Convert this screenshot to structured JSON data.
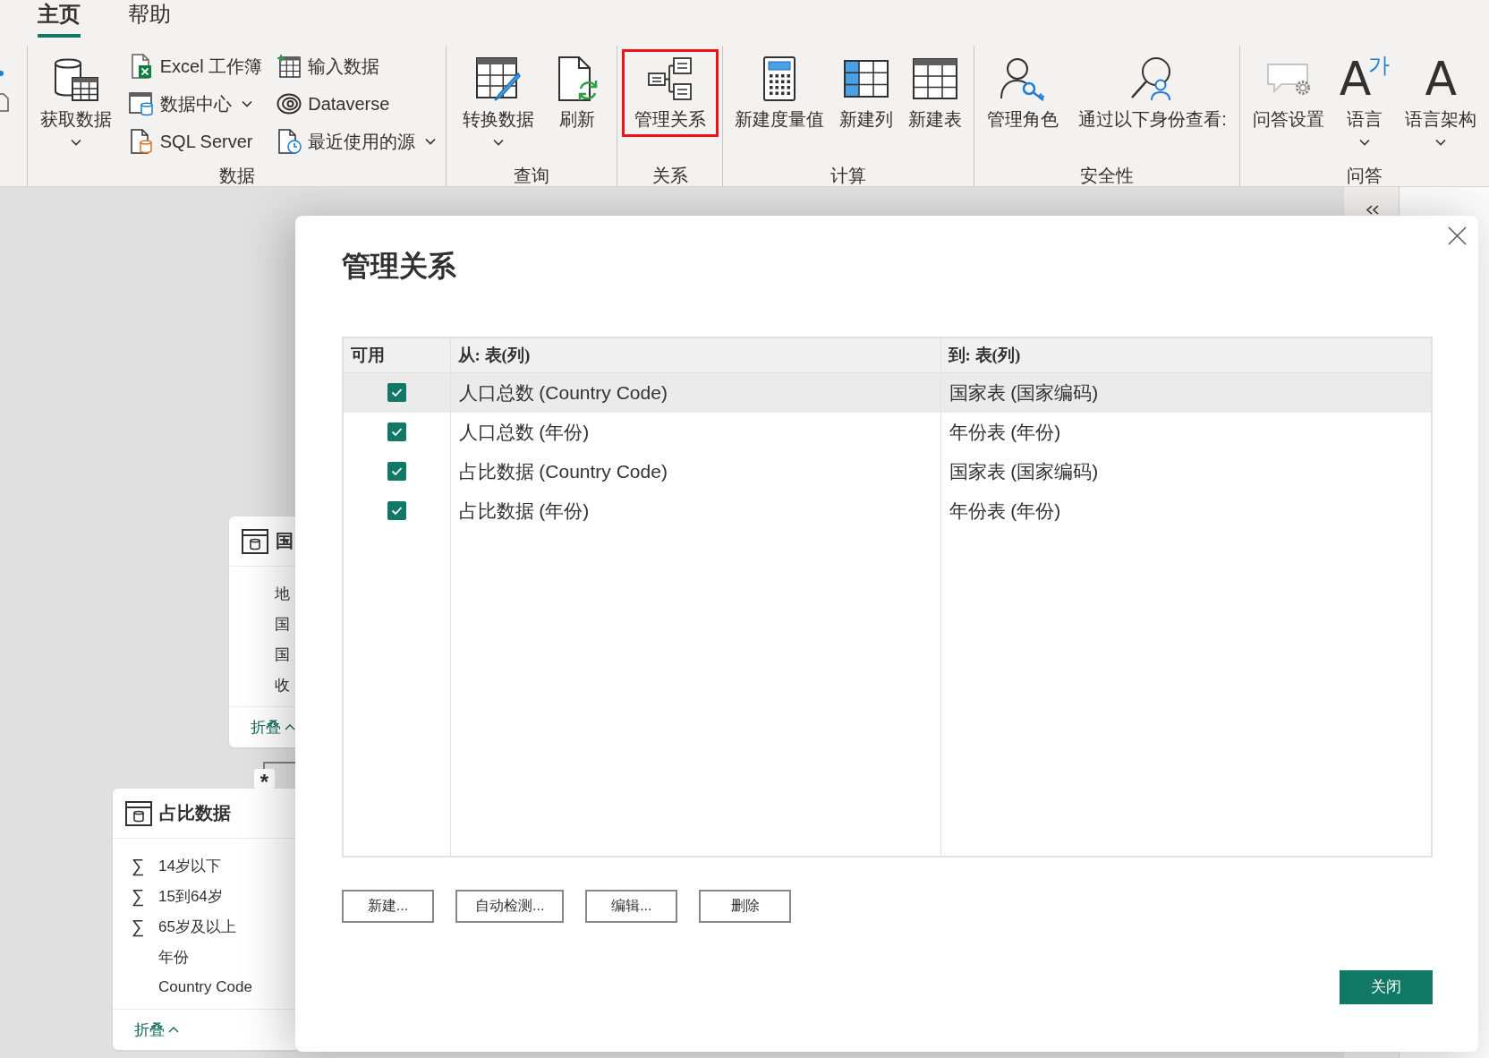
{
  "ribbon": {
    "tabs": [
      {
        "label": "主页",
        "selected": true
      },
      {
        "label": "帮助",
        "selected": false
      }
    ],
    "groups": [
      {
        "label": "数据",
        "items": [
          {
            "kind": "large",
            "label": "获取数据",
            "dropdown": true,
            "highlighted": false
          },
          {
            "kind": "small",
            "label": "Excel 工作簿",
            "dropdown": false,
            "highlighted": false
          },
          {
            "kind": "small",
            "label": "数据中心",
            "dropdown": true,
            "highlighted": false
          },
          {
            "kind": "small",
            "label": "SQL Server",
            "dropdown": false,
            "highlighted": false
          },
          {
            "kind": "small",
            "label": "输入数据",
            "dropdown": false,
            "highlighted": false
          },
          {
            "kind": "small",
            "label": "Dataverse",
            "dropdown": false,
            "highlighted": false
          },
          {
            "kind": "small",
            "label": "最近使用的源",
            "dropdown": true,
            "highlighted": false
          }
        ]
      },
      {
        "label": "查询",
        "items": [
          {
            "kind": "large",
            "label": "转换数据",
            "dropdown": true,
            "highlighted": false
          },
          {
            "kind": "large",
            "label": "刷新",
            "dropdown": false,
            "highlighted": false
          }
        ]
      },
      {
        "label": "关系",
        "items": [
          {
            "kind": "large",
            "label": "管理关系",
            "dropdown": false,
            "highlighted": true
          }
        ]
      },
      {
        "label": "计算",
        "items": [
          {
            "kind": "large",
            "label": "新建度量值",
            "dropdown": false,
            "highlighted": false
          },
          {
            "kind": "large",
            "label": "新建列",
            "dropdown": false,
            "highlighted": false
          },
          {
            "kind": "large",
            "label": "新建表",
            "dropdown": false,
            "highlighted": false
          }
        ]
      },
      {
        "label": "安全性",
        "items": [
          {
            "kind": "large",
            "label": "管理角色",
            "dropdown": false,
            "highlighted": false
          },
          {
            "kind": "large",
            "label": "通过以下身份查看:",
            "dropdown": false,
            "highlighted": false
          }
        ]
      },
      {
        "label": "问答",
        "items": [
          {
            "kind": "large",
            "label": "问答设置",
            "dropdown": false,
            "highlighted": false
          },
          {
            "kind": "large",
            "label": "语言",
            "glyph": "A$^{가}$",
            "dropdown": true,
            "highlighted": false
          },
          {
            "kind": "large",
            "label": "语言架构",
            "glyph": "A",
            "dropdown": true,
            "highlighted": false
          }
        ]
      }
    ]
  },
  "canvas": {
    "tables": [
      {
        "title": "国",
        "fields": [
          {
            "label": "地"
          },
          {
            "label": "国"
          },
          {
            "label": "国"
          },
          {
            "label": "收"
          }
        ],
        "footer": "折叠"
      },
      {
        "title": "占比数据",
        "fields": [
          {
            "symbol": "∑",
            "label": "14岁以下"
          },
          {
            "symbol": "∑",
            "label": "15到64岁"
          },
          {
            "symbol": "∑",
            "label": "65岁及以上"
          },
          {
            "label": "年份"
          },
          {
            "label": "Country Code"
          }
        ],
        "footer": "折叠"
      }
    ],
    "relationship": {
      "cardinality": "*"
    }
  },
  "dialog": {
    "title": "管理关系",
    "columns": [
      "可用",
      "从: 表(列)",
      "到: 表(列)"
    ],
    "relationships": [
      {
        "checked": true,
        "selected": true,
        "from": "人口总数 (Country Code)",
        "to": "国家表 (国家编码)"
      },
      {
        "checked": true,
        "selected": false,
        "from": "人口总数 (年份)",
        "to": "年份表 (年份)"
      },
      {
        "checked": true,
        "selected": false,
        "from": "占比数据 (Country Code)",
        "to": "国家表 (国家编码)"
      },
      {
        "checked": true,
        "selected": false,
        "from": "占比数据 (年份)",
        "to": "年份表 (年份)"
      }
    ],
    "buttons": [
      "新建...",
      "自动检测...",
      "编辑...",
      "删除"
    ],
    "close_button": "关闭"
  }
}
